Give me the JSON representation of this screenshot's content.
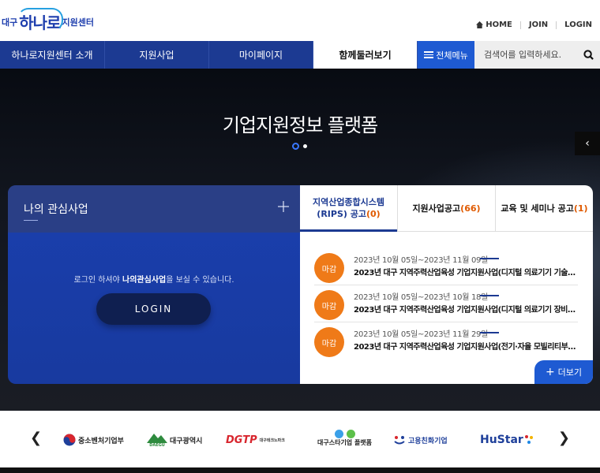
{
  "header": {
    "logo_prefix": "대구",
    "logo_main": "하나로",
    "logo_suffix": "지원센터",
    "util": [
      "HOME",
      "JOIN",
      "LOGIN"
    ]
  },
  "gnb": {
    "items": [
      "하나로지원센터 소개",
      "지원사업",
      "마이페이지",
      "함께둘러보기"
    ],
    "menu_label": "전체메뉴",
    "search_placeholder": "검색어를 입력하세요."
  },
  "hero": {
    "title": "기업지원정보 플랫폼",
    "slide_prev": "‹"
  },
  "interest": {
    "title": "나의 관심사업",
    "msg_pre": "로그인 하셔야 ",
    "msg_bold": "나의관심사업",
    "msg_post": "을 보실 수 있습니다.",
    "login_label": "LOGIN"
  },
  "notice": {
    "tabs": [
      {
        "label": "지역산업종합시스템",
        "label2": "(RIPS) 공고",
        "count": "(0)"
      },
      {
        "label": "지원사업공고",
        "count": "(66)"
      },
      {
        "label": "교육 및 세미나 공고",
        "count": "(1)"
      }
    ],
    "items": [
      {
        "badge": "마감",
        "date": "2023년 10월 05일~2023년 11월 09일",
        "title": "2023년 대구 지역주력산업육성 기업지원사업(디지털 의료기기 기술문…"
      },
      {
        "badge": "마감",
        "date": "2023년 10월 05일~2023년 10월 18일",
        "title": "2023년 대구 지역주력산업육성 기업지원사업(디지털 의료기기 장비활…"
      },
      {
        "badge": "마감",
        "date": "2023년 10월 05일~2023년 11월 29일",
        "title": "2023년 대구 지역주력산업육성 기업지원사업(전기·자율 모빌리티부품 …"
      }
    ],
    "more_label": "더보기"
  },
  "partners": {
    "logos": [
      "중소벤처기업부",
      "대구광역시",
      "DGTP",
      "대구스타기업 플랫폼",
      "고용친화기업",
      "HuStar"
    ],
    "dgtp_sub": "대구테크노파크",
    "daegu_sub": "DAEGU"
  },
  "colors": {
    "navy": "#1c3a92",
    "blue": "#1e5ad2",
    "orange": "#ef7a18"
  }
}
